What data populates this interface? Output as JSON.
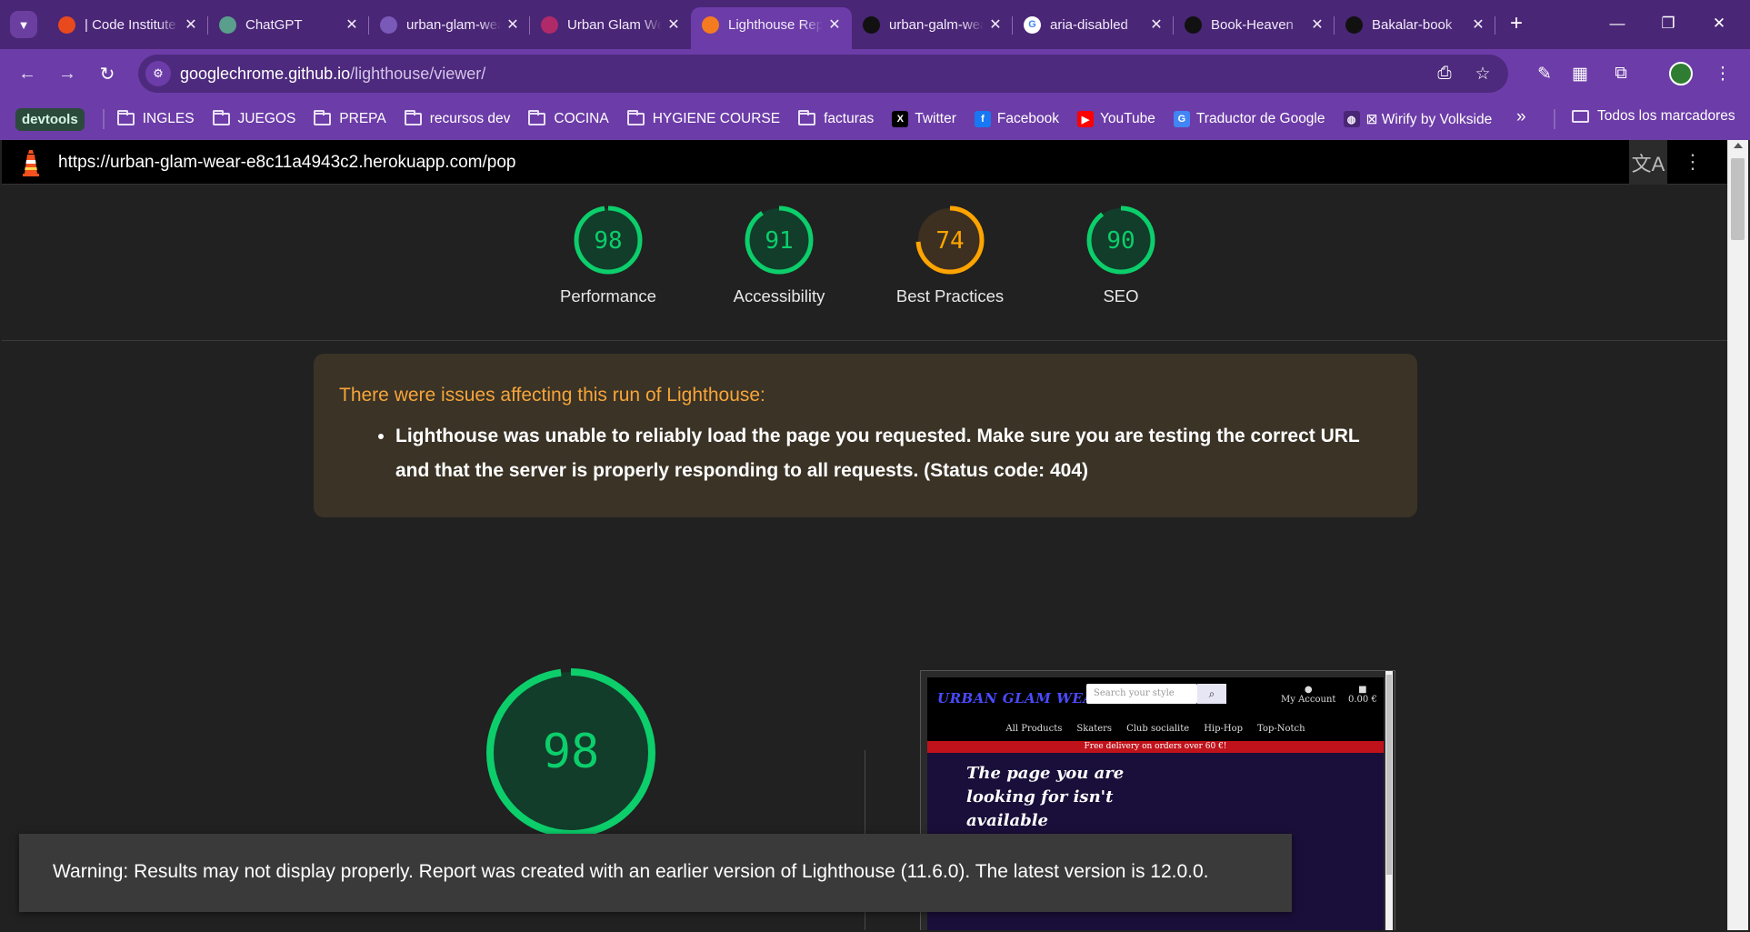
{
  "browser": {
    "tabs": [
      {
        "title": "| Code Institute",
        "icon": "code-institute-icon",
        "color": "#e8491d"
      },
      {
        "title": "ChatGPT",
        "icon": "chatgpt-icon",
        "color": "#5a9e8c"
      },
      {
        "title": "urban-glam-wear",
        "icon": "heroku-icon",
        "color": "#7a5ab8"
      },
      {
        "title": "Urban Glam Wear",
        "icon": "urban-glam-icon",
        "color": "#b02a6a"
      },
      {
        "title": "Lighthouse Report",
        "icon": "lighthouse-icon",
        "color": "#f47b20"
      },
      {
        "title": "urban-galm-wear",
        "icon": "github-icon",
        "color": "#111111"
      },
      {
        "title": "aria-disabled",
        "icon": "google-icon",
        "color": "#ffffff"
      },
      {
        "title": "Book-Heaven",
        "icon": "github-icon",
        "color": "#111111"
      },
      {
        "title": "Bakalar-book",
        "icon": "github-icon",
        "color": "#111111"
      }
    ],
    "active_tab": 4,
    "url_host": "googlechrome.github.io",
    "url_path": "/lighthouse/viewer/",
    "bookmarks": [
      {
        "label": "INGLES",
        "type": "folder"
      },
      {
        "label": "JUEGOS",
        "type": "folder"
      },
      {
        "label": "PREPA",
        "type": "folder"
      },
      {
        "label": "recursos dev",
        "type": "folder"
      },
      {
        "label": "COCINA",
        "type": "folder"
      },
      {
        "label": "HYGIENE COURSE",
        "type": "folder"
      },
      {
        "label": "facturas",
        "type": "folder"
      },
      {
        "label": "Twitter",
        "type": "x-icon"
      },
      {
        "label": "Facebook",
        "type": "facebook-icon"
      },
      {
        "label": "YouTube",
        "type": "youtube-icon"
      },
      {
        "label": "Traductor de Google",
        "type": "translate-icon"
      },
      {
        "label": "⊠ Wirify by Volkside",
        "type": "globe-icon"
      }
    ],
    "bookmark_group": "devtools",
    "all_bookmarks": "Todos los marcadores"
  },
  "lighthouse": {
    "report_url": "https://urban-glam-wear-e8c11a4943c2.herokuapp.com/pop",
    "scores": [
      {
        "label": "Performance",
        "score": 98,
        "color": "#0cce6b",
        "bg": "#123d2a"
      },
      {
        "label": "Accessibility",
        "score": 91,
        "color": "#0cce6b",
        "bg": "#123d2a"
      },
      {
        "label": "Best Practices",
        "score": 74,
        "color": "#ffa400",
        "bg": "#3d3020"
      },
      {
        "label": "SEO",
        "score": 90,
        "color": "#0cce6b",
        "bg": "#123d2a"
      }
    ],
    "warning_heading": "There were issues affecting this run of Lighthouse:",
    "warning_item": "Lighthouse was unable to reliably load the page you requested. Make sure you are testing the correct URL and that the server is properly responding to all requests. (Status code: 404)",
    "big_score": 98,
    "toast": "Warning: Results may not display properly. Report was created with an earlier version of Lighthouse (11.6.0). The latest version is 12.0.0."
  },
  "screenshot_preview": {
    "logo": "URBAN GLAM WEAR",
    "search_placeholder": "Search your style",
    "account_label": "My Account",
    "cart_label": "0.00 €",
    "nav": [
      "All Products",
      "Skaters",
      "Club socialite",
      "Hip-Hop",
      "Top-Notch"
    ],
    "banner": "Free delivery on orders over 60 €!",
    "hero_text": "The page you are looking for isn't available"
  }
}
